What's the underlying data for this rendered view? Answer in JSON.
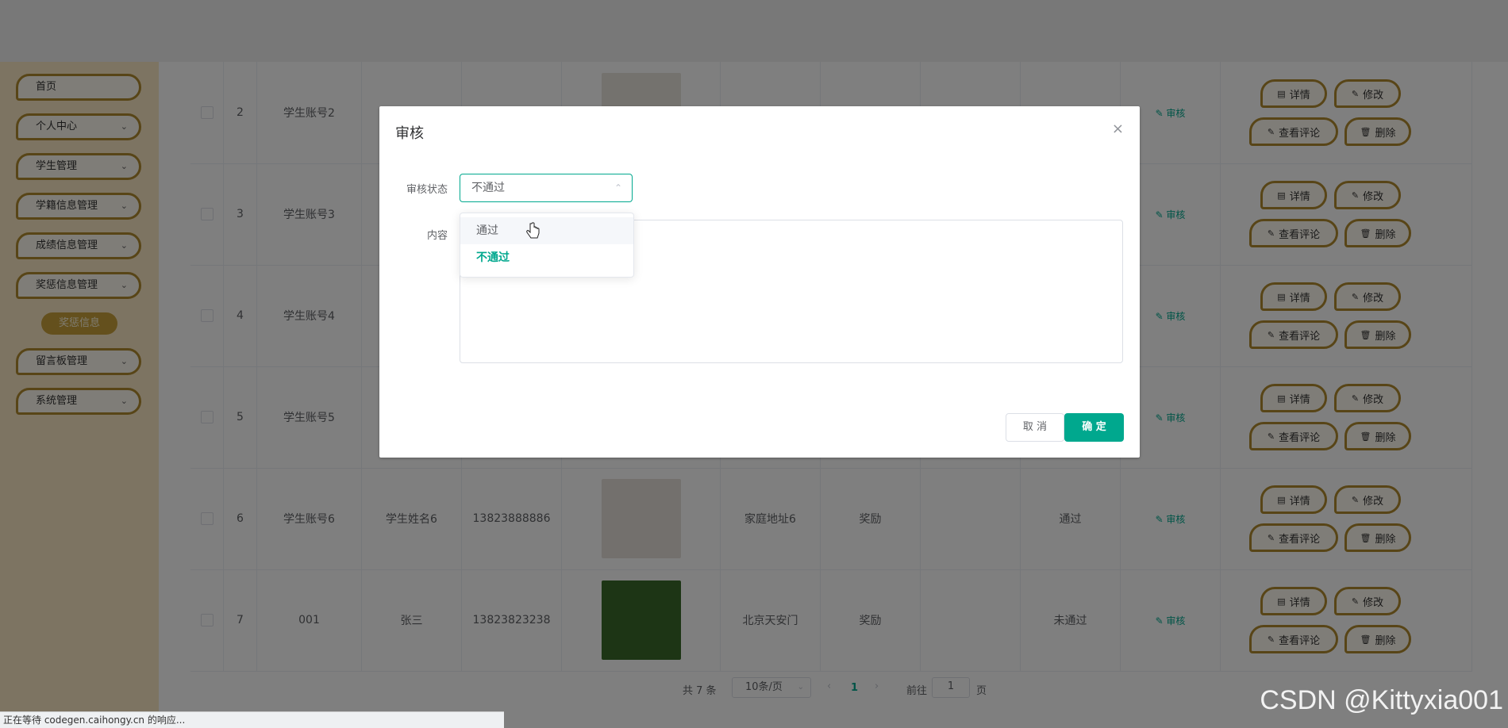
{
  "sidebar": {
    "items": [
      {
        "label": "首页",
        "has_children": false
      },
      {
        "label": "个人中心",
        "has_children": true
      },
      {
        "label": "学生管理",
        "has_children": true
      },
      {
        "label": "学籍信息管理",
        "has_children": true
      },
      {
        "label": "成绩信息管理",
        "has_children": true
      },
      {
        "label": "奖惩信息管理",
        "has_children": true
      },
      {
        "label": "留言板管理",
        "has_children": true
      },
      {
        "label": "系统管理",
        "has_children": true
      }
    ],
    "active_subitem": "奖惩信息"
  },
  "table": {
    "rows": [
      {
        "index": "2",
        "account": "学生账号2",
        "name": "",
        "phone": "",
        "address": "",
        "type": "",
        "status": ""
      },
      {
        "index": "3",
        "account": "学生账号3",
        "name": "",
        "phone": "",
        "address": "",
        "type": "",
        "status": ""
      },
      {
        "index": "4",
        "account": "学生账号4",
        "name": "",
        "phone": "",
        "address": "",
        "type": "",
        "status": ""
      },
      {
        "index": "5",
        "account": "学生账号5",
        "name": "",
        "phone": "",
        "address": "",
        "type": "",
        "status": ""
      },
      {
        "index": "6",
        "account": "学生账号6",
        "name": "学生姓名6",
        "phone": "13823888886",
        "address": "家庭地址6",
        "type": "奖励",
        "status": "通过"
      },
      {
        "index": "7",
        "account": "001",
        "name": "张三",
        "phone": "13823823238",
        "address": "北京天安门",
        "type": "奖励",
        "status": "未通过"
      }
    ],
    "audit_label": "审核",
    "actions": {
      "detail": "详情",
      "edit": "修改",
      "comments": "查看评论",
      "delete": "删除"
    }
  },
  "pagination": {
    "total": "共 7 条",
    "page_size": "10条/页",
    "current_page": "1",
    "goto_prefix": "前往",
    "goto_value": "1",
    "goto_suffix": "页"
  },
  "dialog": {
    "title": "审核",
    "status_label": "审核状态",
    "status_value": "不通过",
    "content_label": "内容",
    "cancel_label": "取 消",
    "ok_label": "确 定"
  },
  "dropdown": {
    "options": [
      "通过",
      "不通过"
    ],
    "selected": "不通过"
  },
  "browser_status": "正在等待 codegen.caihongy.cn 的响应...",
  "watermark": "CSDN @Kittyxia001",
  "colors": {
    "accent": "#00a88e",
    "menu_border": "#b08a2e",
    "sidebar_bg": "#fbe8c4"
  }
}
